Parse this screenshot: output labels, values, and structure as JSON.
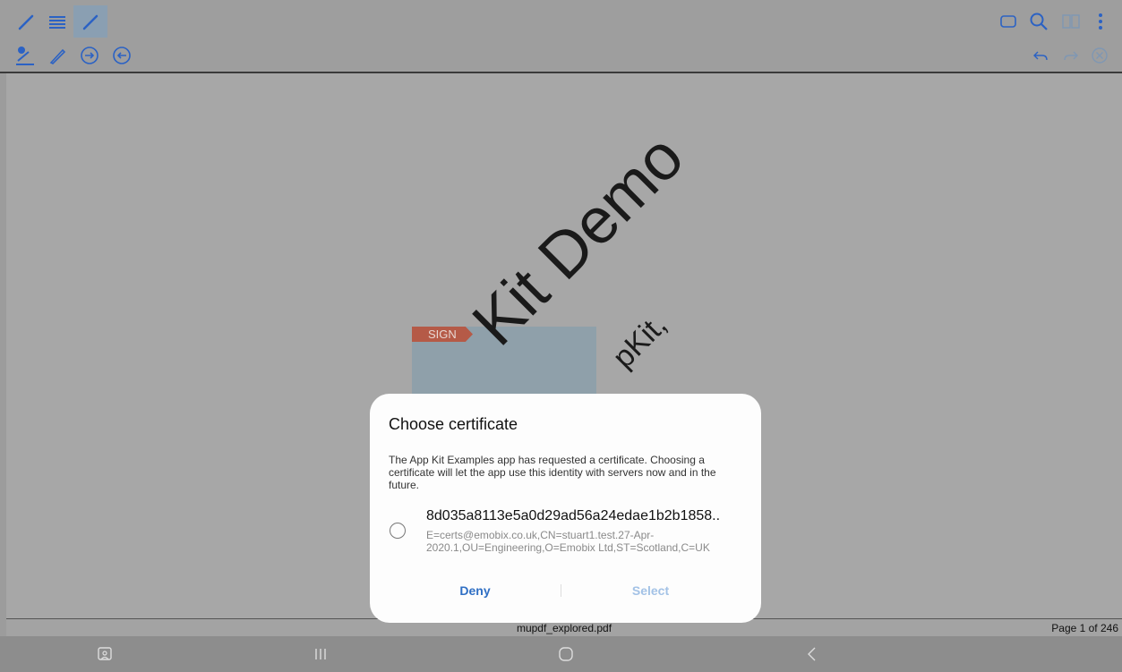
{
  "toolbar": {
    "left_row1_icons": [
      "pen-icon",
      "text-lines-icon",
      "highlight-pen-icon"
    ],
    "left_row2_icons": [
      "signature-icon",
      "ink-sign-icon",
      "next-field-icon",
      "previous-field-icon"
    ],
    "right_row1_icons": [
      "rectangle-icon",
      "search-icon",
      "book-icon",
      "more-vertical-icon"
    ],
    "right_row2_icons": [
      "undo-icon",
      "redo-icon",
      "cancel-icon"
    ],
    "accent": "#2b62c4"
  },
  "document": {
    "watermark_main": "Kit Demo",
    "watermark_sub": "pKit,",
    "sign_label": "SIGN"
  },
  "status": {
    "filename": "mupdf_explored.pdf",
    "page_info": "Page 1 of 246"
  },
  "navbar": {
    "icons": [
      "screenshot-icon",
      "recents-icon",
      "home-icon",
      "back-icon"
    ]
  },
  "dialog": {
    "title": "Choose certificate",
    "message": "The App Kit Examples app has requested a certificate. Choosing a certificate will let the app use this identity with servers now and in the future.",
    "certificate": {
      "name": "8d035a8113e5a0d29ad56a24edae1b2b1858..",
      "detail": "E=certs@emobix.co.uk,CN=stuart1.test.27-Apr-2020.1,OU=Engineering,O=Emobix Ltd,ST=Scotland,C=UK",
      "selected": false
    },
    "deny_label": "Deny",
    "select_label": "Select",
    "deny_color": "#2f6fc4",
    "select_color_disabled": "#a3c2e6"
  }
}
